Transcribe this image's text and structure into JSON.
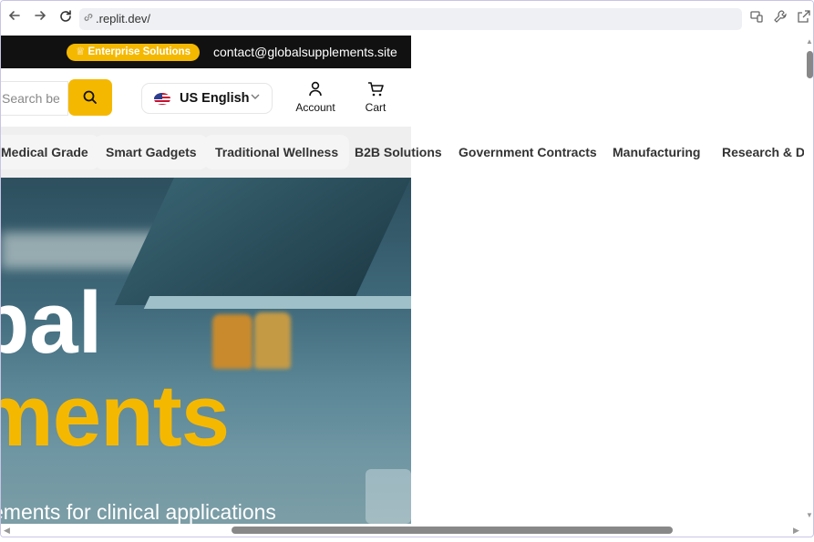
{
  "browser": {
    "url": ".replit.dev/",
    "back_icon": "arrow-left",
    "forward_icon": "arrow-right",
    "reload_icon": "reload"
  },
  "topbar": {
    "badge_icon": "crown-icon",
    "badge_label": "Enterprise Solutions",
    "contact_email": "contact@globalsupplements.site"
  },
  "header": {
    "search_placeholder": "Search be",
    "language_label": "US English",
    "account_label": "Account",
    "cart_label": "Cart"
  },
  "categories": [
    "Medical Grade",
    "Smart Gadgets",
    "Traditional Wellness",
    "B2B Solutions",
    "Government Contracts",
    "Manufacturing",
    "Research & De"
  ],
  "hero": {
    "line1": "obal",
    "line2": "ements",
    "subtitle": "ements for clinical applications"
  },
  "colors": {
    "accent": "#f5b800",
    "topbar_bg": "#111111"
  }
}
